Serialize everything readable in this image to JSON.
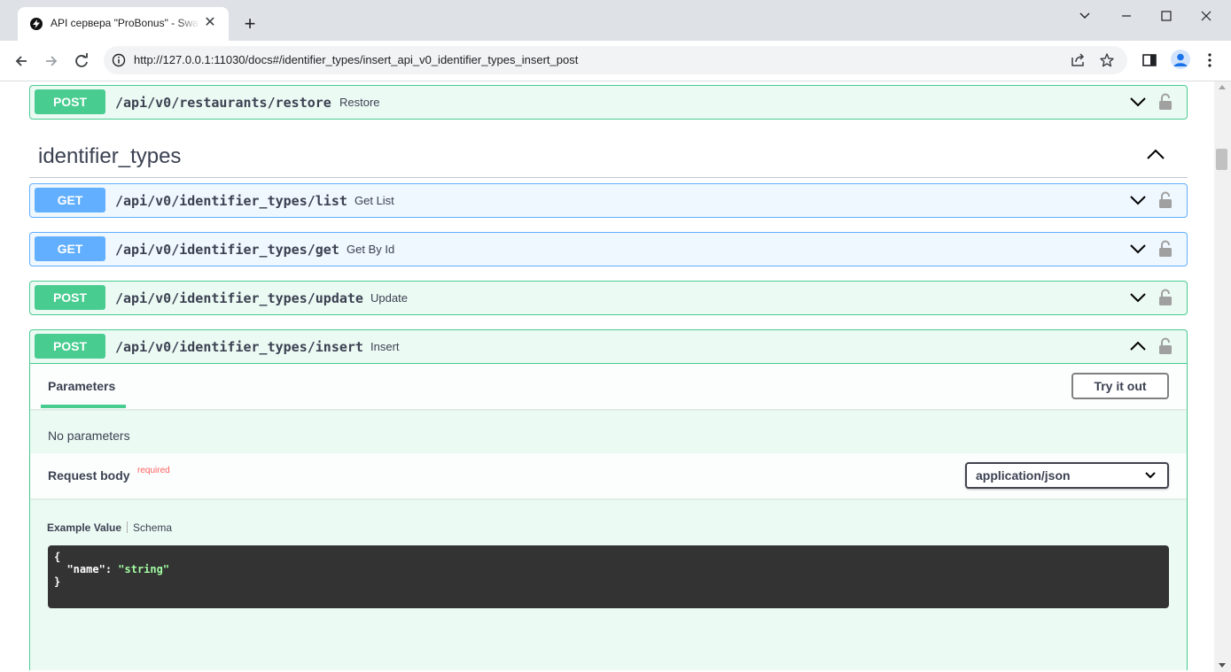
{
  "browser": {
    "tab_title": "API сервера \"ProBonus\" - Swagger UI",
    "url": "http://127.0.0.1:11030/docs#/identifier_types/insert_api_v0_identifier_types_insert_post"
  },
  "operations_above": [
    {
      "method": "POST",
      "path": "/api/v0/restaurants/restore",
      "summary": "Restore"
    }
  ],
  "tag": {
    "name": "identifier_types"
  },
  "operations": [
    {
      "method": "GET",
      "path": "/api/v0/identifier_types/list",
      "summary": "Get List"
    },
    {
      "method": "GET",
      "path": "/api/v0/identifier_types/get",
      "summary": "Get By Id"
    },
    {
      "method": "POST",
      "path": "/api/v0/identifier_types/update",
      "summary": "Update"
    },
    {
      "method": "POST",
      "path": "/api/v0/identifier_types/insert",
      "summary": "Insert"
    }
  ],
  "expanded": {
    "parameters_title": "Parameters",
    "try_it_out": "Try it out",
    "no_parameters": "No parameters",
    "request_body_title": "Request body",
    "required_label": "required",
    "content_type": "application/json",
    "example_value_tab": "Example Value",
    "schema_tab": "Schema",
    "example": {
      "open": "{",
      "key": "\"name\"",
      "colon": ": ",
      "value": "\"string\"",
      "close": "}"
    }
  },
  "colors": {
    "post": "#49cc90",
    "get": "#61affe",
    "code_bg": "#333333",
    "required": "#ff6060"
  }
}
